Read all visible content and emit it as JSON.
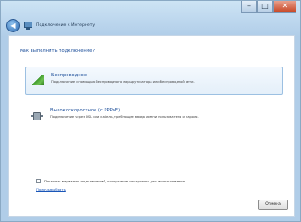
{
  "window": {
    "title": "Подключение к Интернету",
    "controls": {
      "minimize": "–",
      "maximize": "□",
      "close": "✕"
    }
  },
  "icons": {
    "back": "back-arrow-icon",
    "network": "network-computer-icon",
    "wireless": "wireless-signal-icon",
    "pppoe": "broadband-cable-icon"
  },
  "colors": {
    "accent_text": "#1d4f9a",
    "link": "#1a56b8",
    "selection_border": "#9cc0e2"
  },
  "page": {
    "heading": "Как выполнить подключение?",
    "options": [
      {
        "title": "Беспроводное",
        "description": "Подключение с помощью беспроводного маршрутизатора или беспроводной сети."
      },
      {
        "title": "Высокоскоростное (с PPPoE)",
        "description": "Подключение через DSL или кабель, требующее ввода имени пользователя и пароля."
      }
    ],
    "checkbox_label": "Показать варианты подключений, которые не настроены для использования",
    "help_link": "Помочь выбрать",
    "cancel_label": "Отмена"
  }
}
